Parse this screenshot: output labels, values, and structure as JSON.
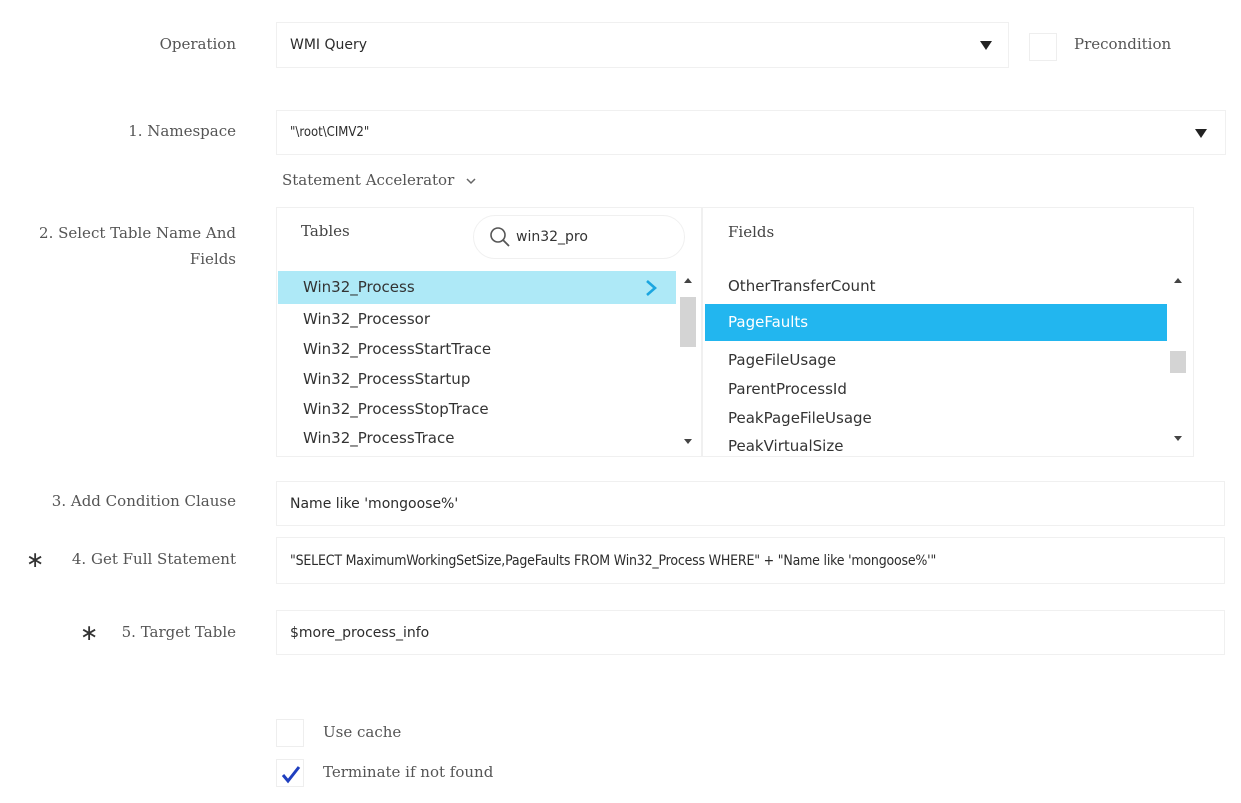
{
  "operation": {
    "label": "Operation",
    "value": "WMI Query",
    "precondition_label": "Precondition"
  },
  "namespace": {
    "label": "1. Namespace",
    "value": "\"\\root\\CIMV2\"",
    "accelerator_label": "Statement Accelerator"
  },
  "table_select": {
    "label_line1": "2. Select Table Name And",
    "label_line2": "Fields",
    "tables_header": "Tables",
    "search_value": "win32_pro",
    "fields_header": "Fields",
    "tables": [
      "Win32_Process",
      "Win32_Processor",
      "Win32_ProcessStartTrace",
      "Win32_ProcessStartup",
      "Win32_ProcessStopTrace",
      "Win32_ProcessTrace"
    ],
    "fields": [
      "OtherTransferCount",
      "PageFaults",
      "PageFileUsage",
      "ParentProcessId",
      "PeakPageFileUsage",
      "PeakVirtualSize"
    ]
  },
  "condition": {
    "label": "3. Add Condition Clause",
    "value": "Name like 'mongoose%'"
  },
  "full_statement": {
    "label": "4. Get Full Statement",
    "value": "\"SELECT MaximumWorkingSetSize,PageFaults FROM Win32_Process WHERE\" + \"Name like 'mongoose%'\""
  },
  "target_table": {
    "label": "5. Target Table",
    "value": "$more_process_info"
  },
  "options": {
    "use_cache_label": "Use cache",
    "terminate_label": "Terminate if not found"
  },
  "colors": {
    "selected_light": "#aee9f7",
    "selected_blue": "#22b6ef",
    "check": "#1f3fbf",
    "chevron": "#1ba6e0"
  }
}
